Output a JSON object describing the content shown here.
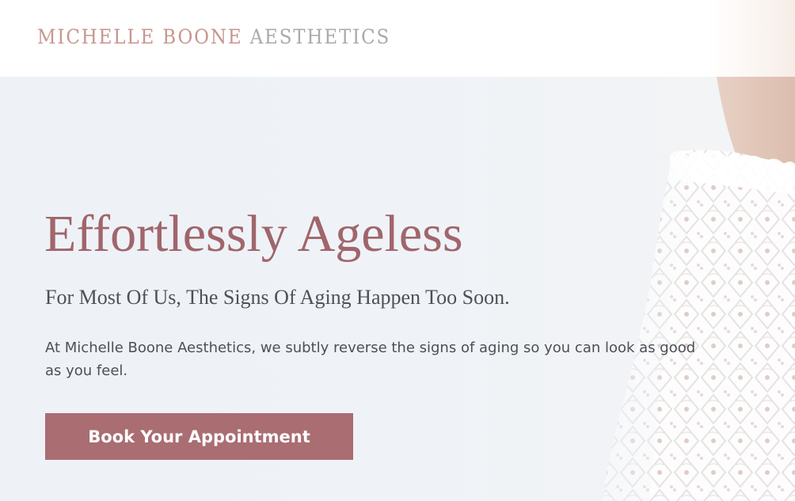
{
  "header": {
    "logo": {
      "primary": "MICHELLE BOONE",
      "secondary": "AESTHETICS"
    }
  },
  "hero": {
    "title": "Effortlessly Ageless",
    "subtitle": "For Most Of Us, The Signs Of Aging Happen Too Soon.",
    "body": "At Michelle Boone Aesthetics, we subtly reverse the signs of aging so you can look as good as you feel.",
    "cta_label": "Book Your Appointment"
  },
  "colors": {
    "brand_rose": "#a96d72",
    "title_rose": "#a1656c",
    "logo_rose": "#c7968f",
    "logo_gray": "#aaaaaa",
    "text_dark": "#4c4f57",
    "hero_background": "#eff3f7"
  }
}
